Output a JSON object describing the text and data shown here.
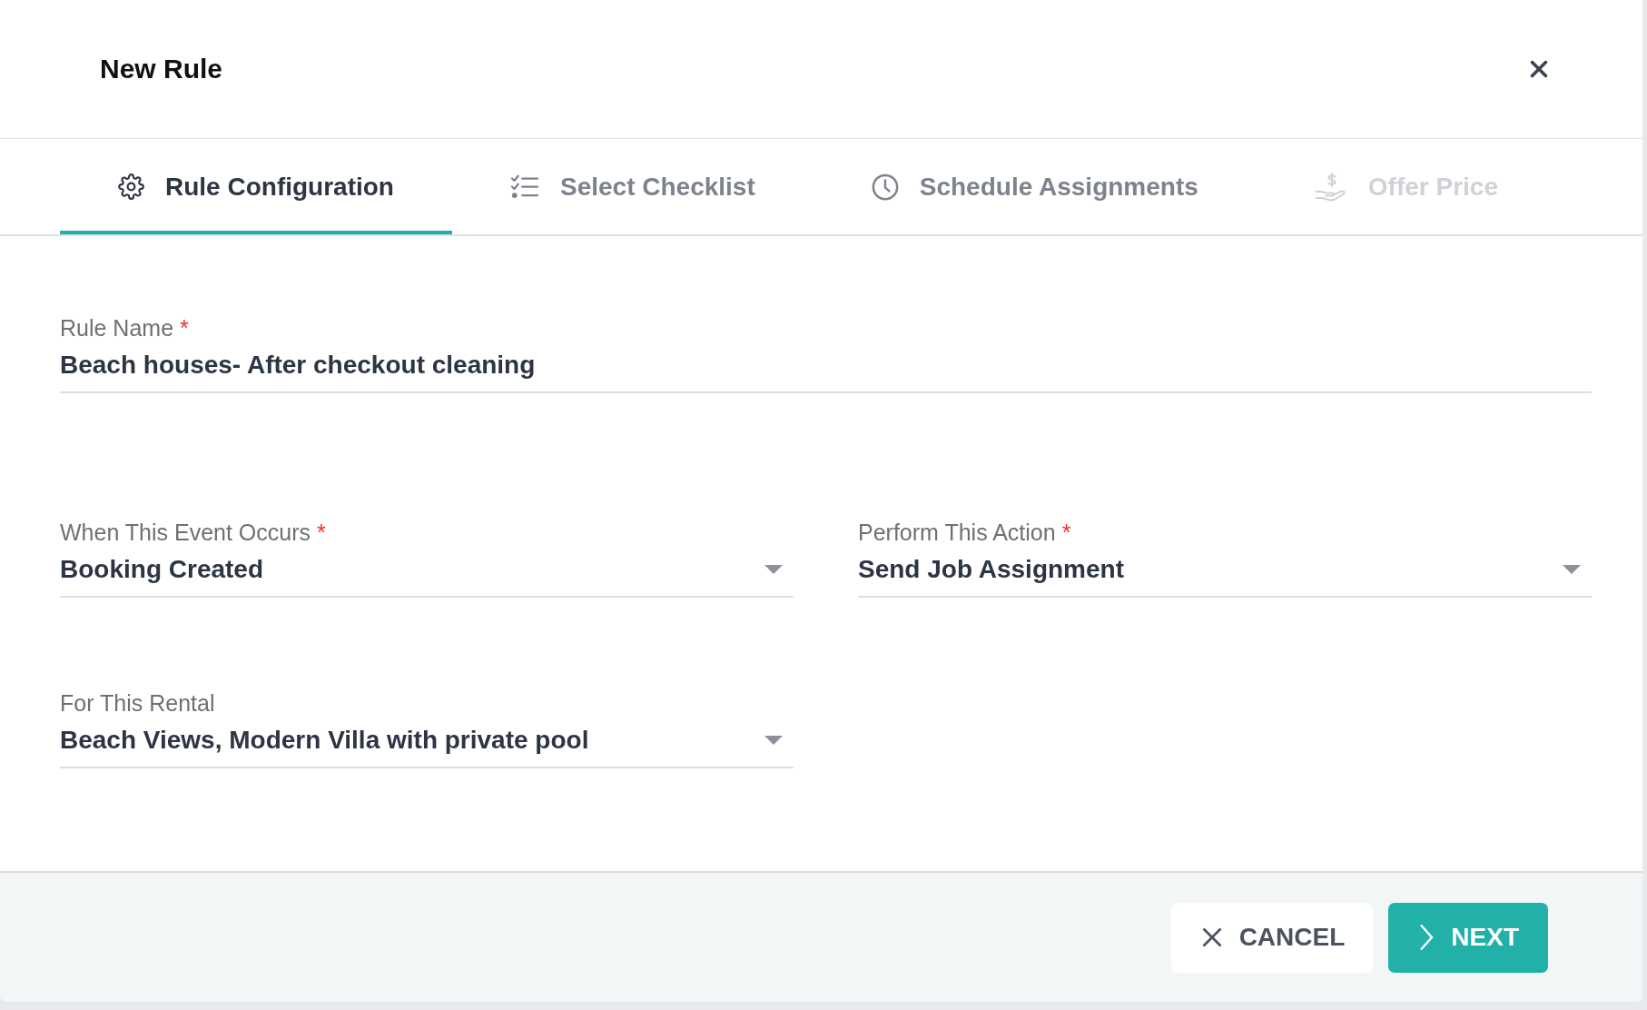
{
  "dialog": {
    "title": "New Rule"
  },
  "tabs": [
    {
      "label": "Rule Configuration",
      "selected": true,
      "disabled": false
    },
    {
      "label": "Select Checklist",
      "selected": false,
      "disabled": false
    },
    {
      "label": "Schedule Assignments",
      "selected": false,
      "disabled": false
    },
    {
      "label": "Offer Price",
      "selected": false,
      "disabled": true
    }
  ],
  "fields": [
    {
      "kind": "text",
      "label": "Rule Name",
      "required_mark": "*",
      "value": "Beach houses- After checkout cleaning"
    },
    {
      "kind": "select",
      "label": "When This Event Occurs",
      "required_mark": "*",
      "value": "Booking Created"
    },
    {
      "kind": "select",
      "label": "Perform This Action",
      "required_mark": "*",
      "value": "Send Job Assignment"
    },
    {
      "kind": "select",
      "label": "For This Rental",
      "value": "Beach Views, Modern Villa with private pool"
    }
  ],
  "buttons": [
    {
      "kind": "secondary",
      "label": "CANCEL"
    },
    {
      "kind": "primary",
      "label": "NEXT"
    }
  ]
}
